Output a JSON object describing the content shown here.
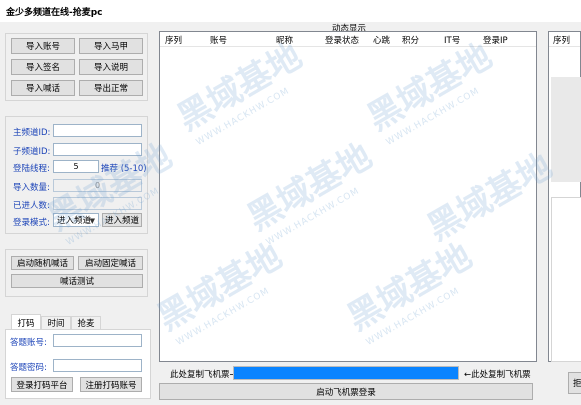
{
  "window": {
    "title": "金少多频道在线-抢麦pc"
  },
  "left_buttons": {
    "import_account": "导入账号",
    "import_horse": "导入马甲",
    "import_sign": "导入签名",
    "import_desc": "导入说明",
    "import_shout": "导入喊话",
    "export_normal": "导出正常"
  },
  "settings": {
    "main_channel_label": "主频道ID:",
    "main_channel_value": "",
    "sub_channel_label": "子频道ID:",
    "sub_channel_value": "",
    "threads_label": "登陆线程:",
    "threads_value": "5",
    "threads_hint": "推荐 (5-10)",
    "import_count_label": "导入数量:",
    "import_count_value": "0",
    "entered_label": "已进人数:",
    "entered_value": "",
    "login_mode_label": "登录模式:",
    "login_mode_value": "进入频道",
    "enter_channel_button": "进入频道"
  },
  "shout": {
    "start_random": "启动随机喊话",
    "start_fixed": "启动固定喊话",
    "test": "喊话测试"
  },
  "tabs": [
    "打码",
    "时间",
    "抢麦"
  ],
  "captcha": {
    "account_label": "答题账号:",
    "account_value": "",
    "password_label": "答题密码:",
    "password_value": "",
    "login_platform": "登录打码平台",
    "register_account": "注册打码账号"
  },
  "dynamic_display": {
    "title": "动态显示",
    "columns": [
      "序列",
      "账号",
      "昵称",
      "登录状态",
      "心跳",
      "积分",
      "IT号",
      "登录IP"
    ]
  },
  "ticket": {
    "left_label": "此处复制飞机票→",
    "right_label": "←此处复制飞机票",
    "start_button": "启动飞机票登录",
    "progress": 1.0
  },
  "right_panel": {
    "column": "序列",
    "partial_button": "拒"
  },
  "watermark": {
    "text": "黑域基地",
    "url": "WWW.HACKHW.COM"
  },
  "colors": {
    "progress": "#0a84ff",
    "label_blue": "#1c44b8"
  }
}
